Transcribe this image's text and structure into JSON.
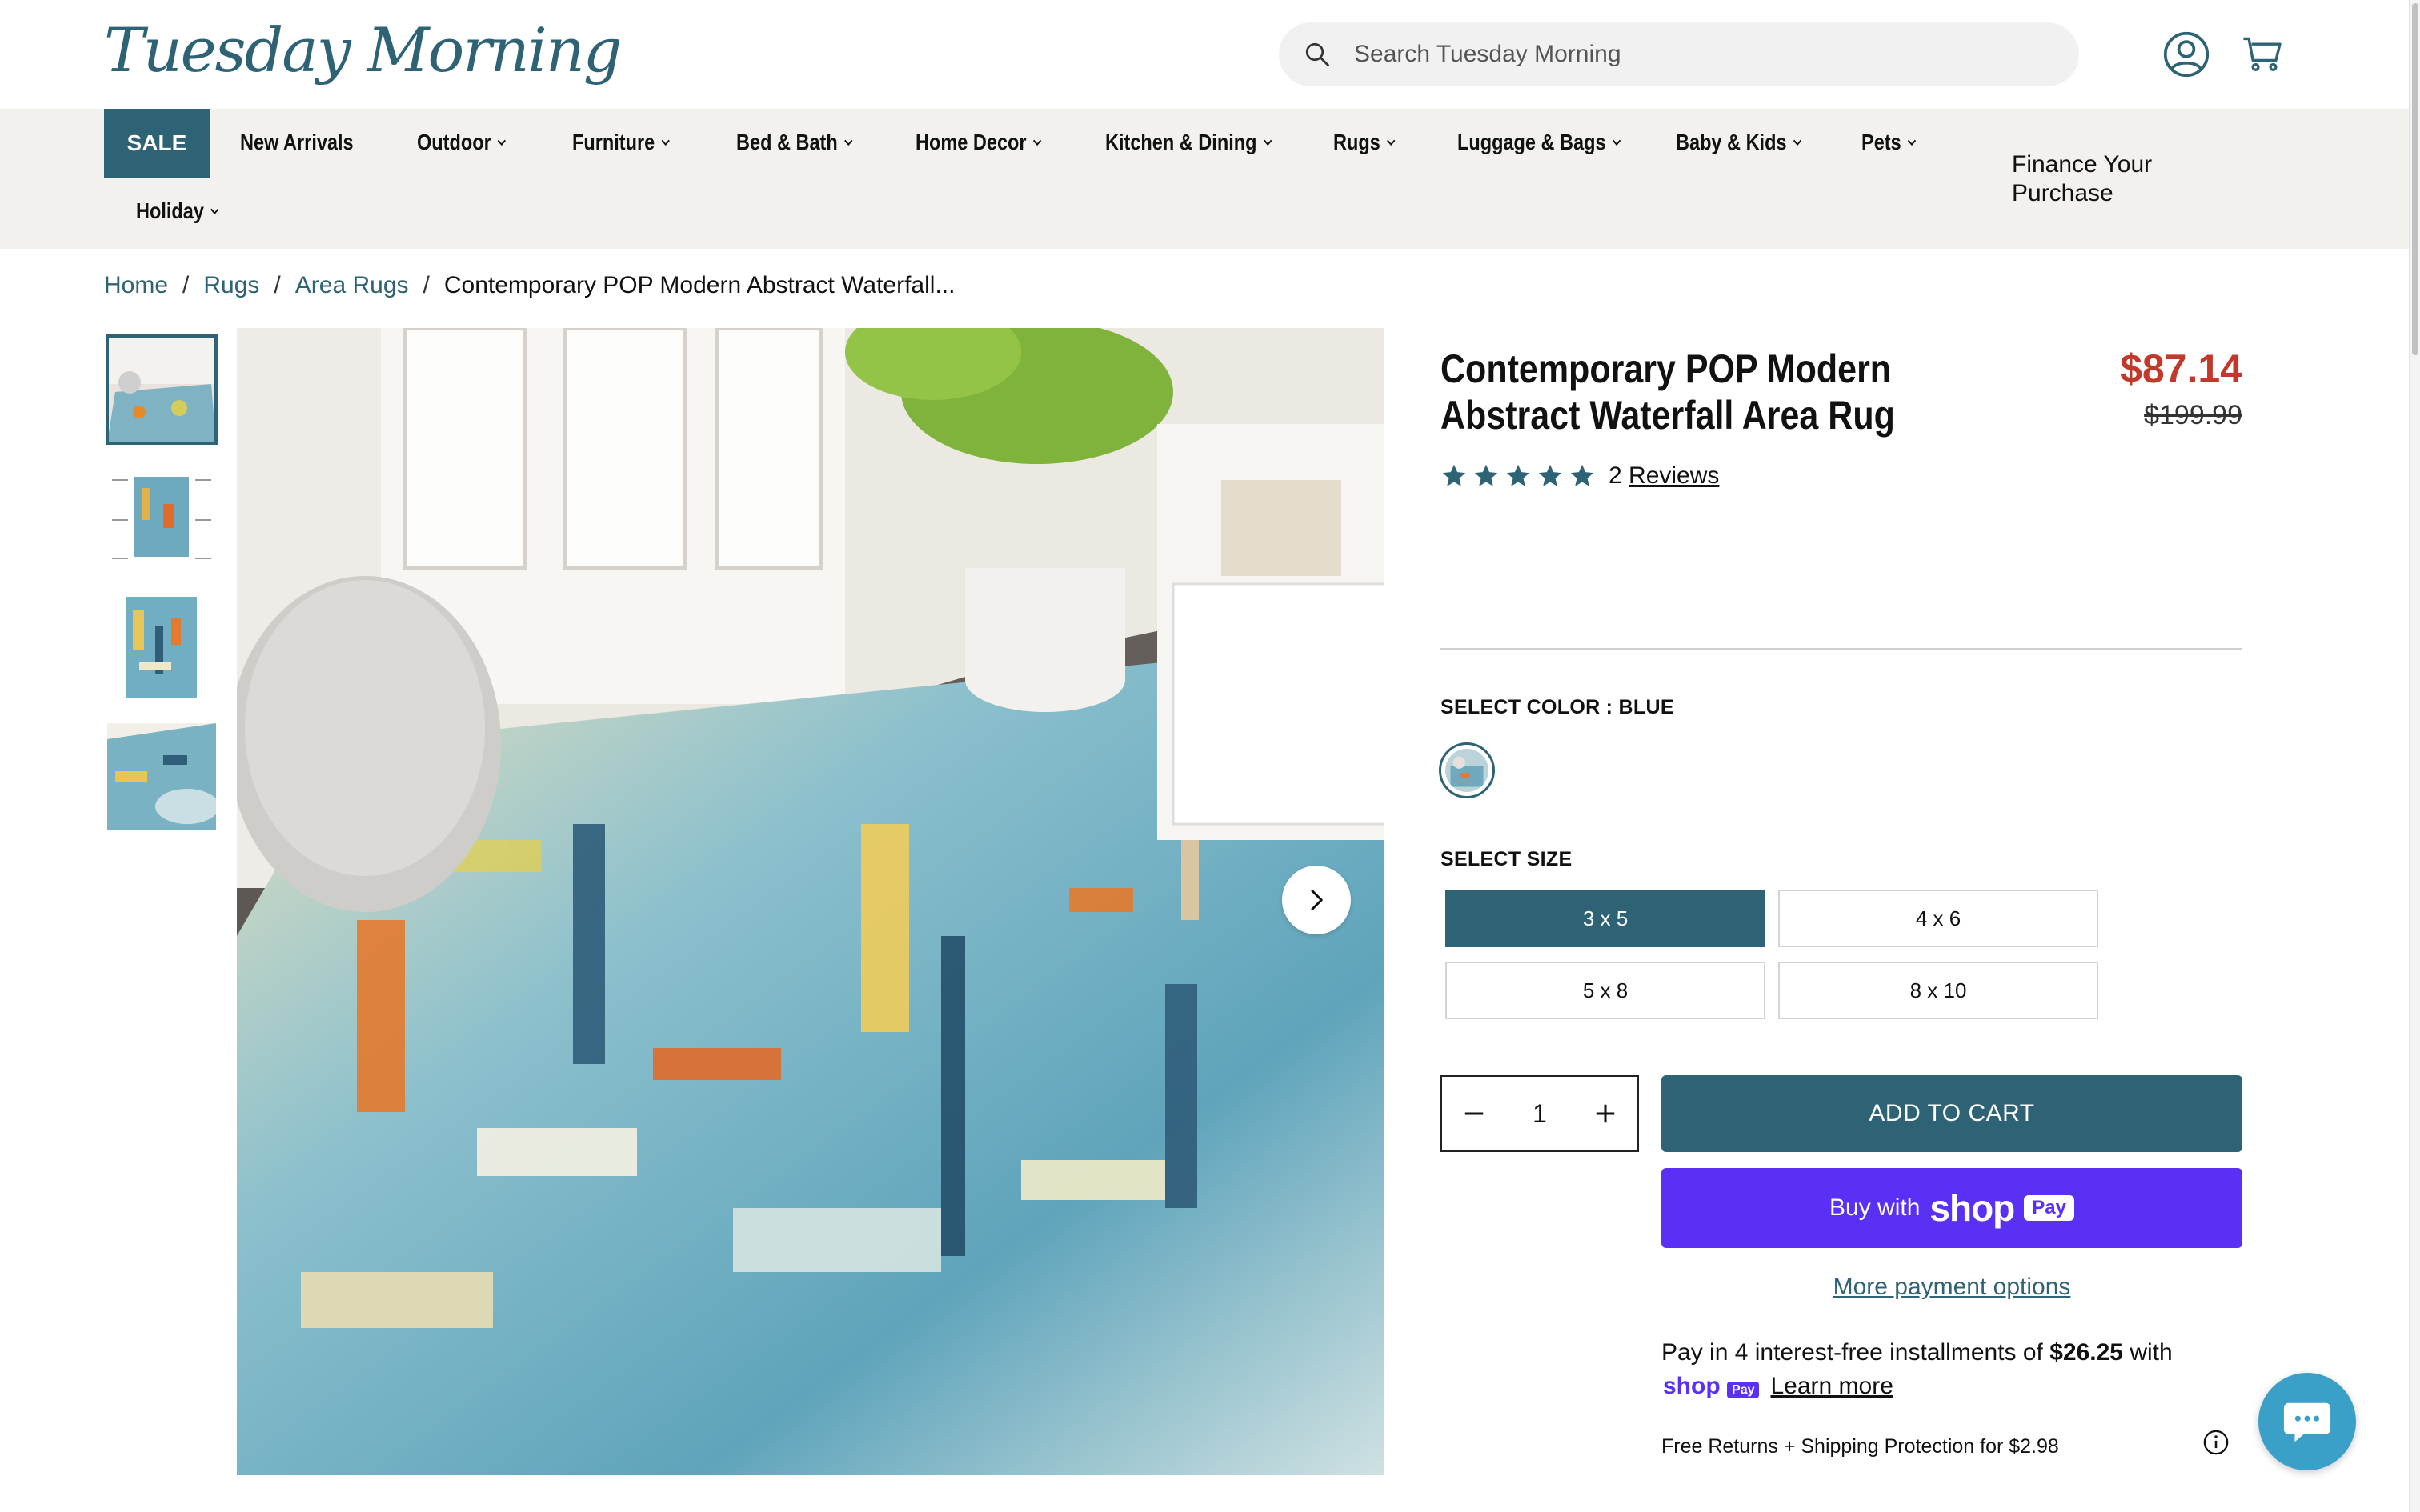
{
  "brand": {
    "logo_text": "Tuesday Morning",
    "accent": "#2e6275",
    "sale_red": "#c0392b",
    "shop_purple": "#5a31f4"
  },
  "search": {
    "placeholder": "Search Tuesday Morning",
    "icon": "search-icon"
  },
  "header_icons": {
    "account": "account-icon",
    "cart": "cart-icon"
  },
  "nav": {
    "sale": "SALE",
    "items": [
      {
        "label": "New Arrivals",
        "dropdown": false
      },
      {
        "label": "Outdoor",
        "dropdown": true
      },
      {
        "label": "Furniture",
        "dropdown": true
      },
      {
        "label": "Bed & Bath",
        "dropdown": true
      },
      {
        "label": "Home Decor",
        "dropdown": true
      },
      {
        "label": "Kitchen & Dining",
        "dropdown": true
      },
      {
        "label": "Rugs",
        "dropdown": true
      },
      {
        "label": "Luggage & Bags",
        "dropdown": true
      },
      {
        "label": "Baby & Kids",
        "dropdown": true
      },
      {
        "label": "Pets",
        "dropdown": true
      },
      {
        "label": "Holiday",
        "dropdown": true
      }
    ],
    "finance": "Finance Your Purchase"
  },
  "breadcrumb": {
    "home": "Home",
    "rugs": "Rugs",
    "area_rugs": "Area Rugs",
    "current": "Contemporary POP Modern Abstract Waterfall...",
    "separator": "/"
  },
  "gallery": {
    "thumbnail_count": 4,
    "active_index": 0,
    "next_icon": "chevron-right-icon"
  },
  "product": {
    "title": "Contemporary POP Modern Abstract Waterfall Area Rug",
    "price": "$87.14",
    "compare_price": "$199.99",
    "rating": 5,
    "reviews_count": "2",
    "reviews_label": "Reviews",
    "color_label": "SELECT COLOR : BLUE",
    "size_label": "SELECT SIZE",
    "sizes": [
      "3 x 5",
      "4 x 6",
      "5 x 8",
      "8 x 10"
    ],
    "selected_size": "3 x 5",
    "quantity": "1",
    "add_to_cart": "ADD TO CART",
    "buy_with": "Buy with",
    "shop_brand": "shop",
    "shop_pay": "Pay",
    "more_payment": "More payment options",
    "installments": {
      "prefix": "Pay in 4 interest-free installments of ",
      "amount": "$26.25",
      "suffix": " with"
    },
    "learn_more": "Learn more",
    "returns": "Free Returns + Shipping Protection for $2.98"
  },
  "chat": {
    "icon": "chat-icon"
  }
}
